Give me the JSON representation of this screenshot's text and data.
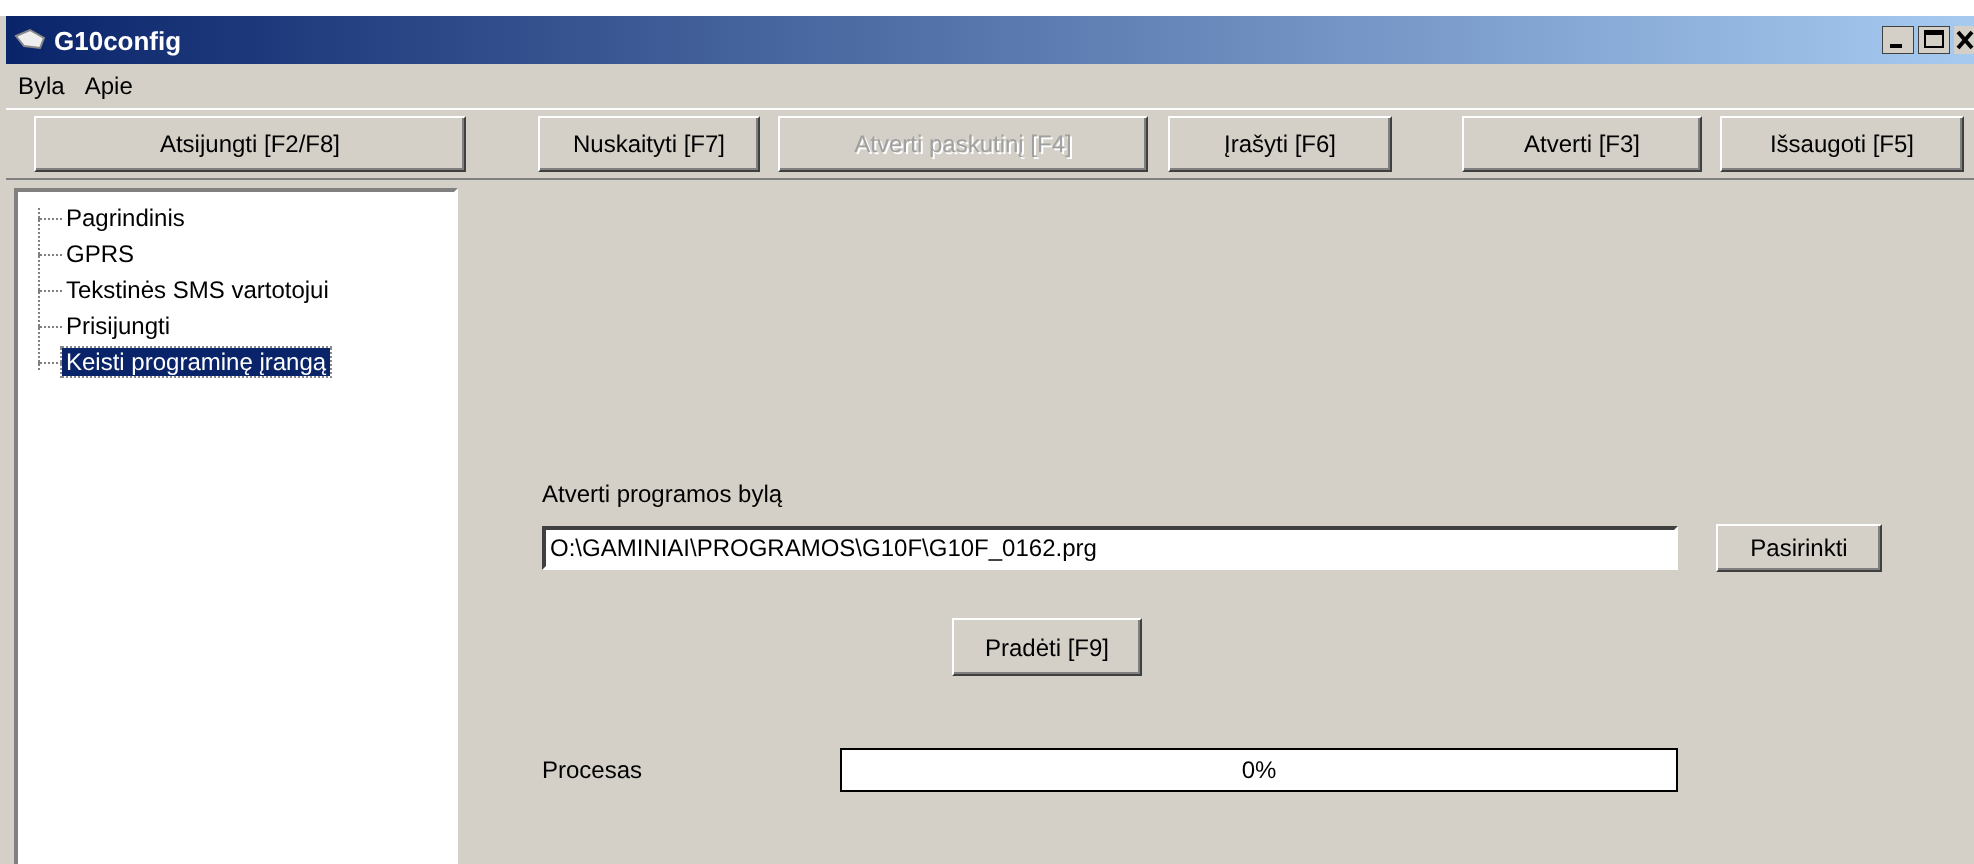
{
  "window": {
    "title": "G10config"
  },
  "menu": [
    {
      "label": "Byla"
    },
    {
      "label": "Apie"
    }
  ],
  "toolbar": [
    {
      "label": "Atsijungti [F2/F8]",
      "disabled": false
    },
    {
      "label": "Nuskaityti [F7]",
      "disabled": false
    },
    {
      "label": "Atverti paskutinį [F4]",
      "disabled": true
    },
    {
      "label": "Įrašyti [F6]",
      "disabled": false
    },
    {
      "label": "Atverti [F3]",
      "disabled": false
    },
    {
      "label": "Išsaugoti [F5]",
      "disabled": false
    }
  ],
  "tree": [
    {
      "label": "Pagrindinis",
      "selected": false
    },
    {
      "label": "GPRS",
      "selected": false
    },
    {
      "label": "Tekstinės SMS vartotojui",
      "selected": false
    },
    {
      "label": "Prisijungti",
      "selected": false
    },
    {
      "label": "Keisti programinę įrangą",
      "selected": true
    }
  ],
  "panel": {
    "file_label": "Atverti programos bylą",
    "file_value": "O:\\GAMINIAI\\PROGRAMOS\\G10F\\G10F_0162.prg",
    "browse_button": "Pasirinkti",
    "start_button": "Pradėti [F9]",
    "process_label": "Procesas",
    "progress": {
      "level": 0,
      "text": "0%"
    }
  }
}
